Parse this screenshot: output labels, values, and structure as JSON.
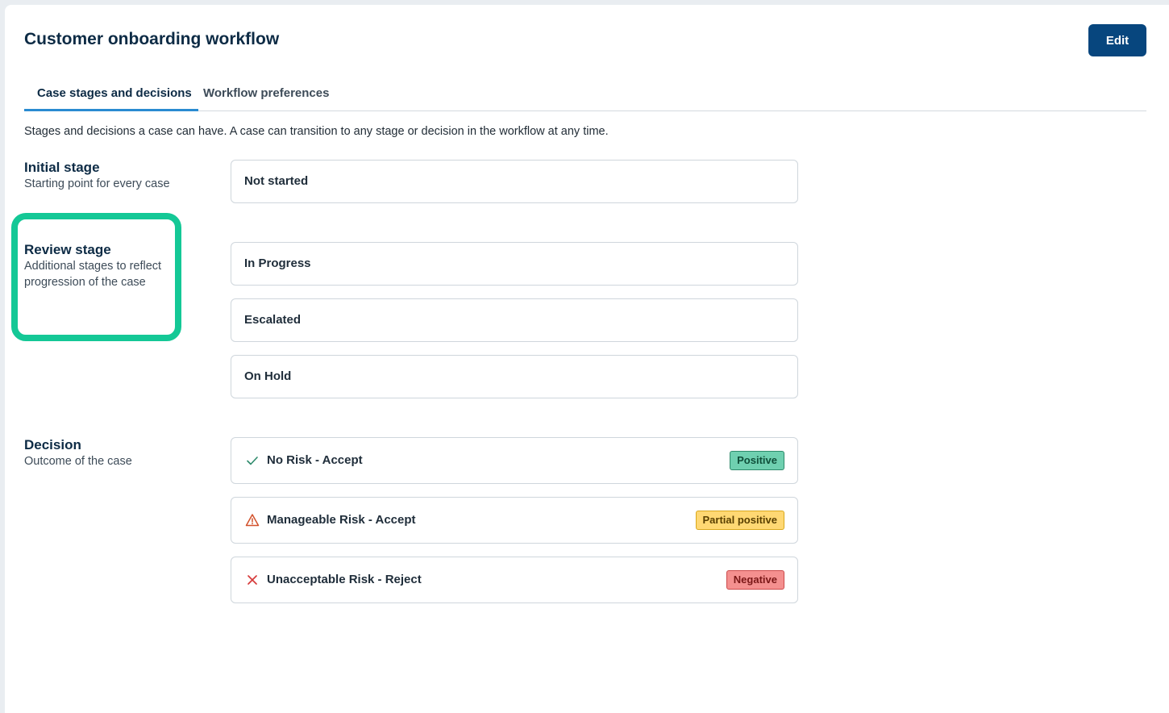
{
  "header": {
    "title": "Customer onboarding workflow",
    "edit_label": "Edit"
  },
  "tabs": [
    {
      "label": "Case stages and decisions",
      "active": true
    },
    {
      "label": "Workflow preferences",
      "active": false
    }
  ],
  "intro": "Stages and decisions a case can have. A case can transition to any stage or decision in the workflow at any time.",
  "initial_stage": {
    "title": "Initial stage",
    "subtitle": "Starting point for every case",
    "items": [
      "Not started"
    ]
  },
  "review_stage": {
    "title": "Review stage",
    "subtitle_line1": "Additional stages to reflect",
    "subtitle_line2": "progression of the case",
    "items": [
      "In Progress",
      "Escalated",
      "On Hold"
    ]
  },
  "decision": {
    "title": "Decision",
    "subtitle": "Outcome of the case",
    "items": [
      {
        "label": "No Risk - Accept",
        "icon": "check-icon",
        "badge": "Positive",
        "color": "#6fd0b0"
      },
      {
        "label": "Manageable Risk - Accept",
        "icon": "warning-icon",
        "badge": "Partial positive",
        "color": "#ffd873"
      },
      {
        "label": "Unacceptable Risk - Reject",
        "icon": "x-icon",
        "badge": "Negative",
        "color": "#f4908f"
      }
    ]
  },
  "colors": {
    "primary": "#07467e",
    "tab_indicator": "#2a8bd1",
    "highlight": "#14c896"
  }
}
